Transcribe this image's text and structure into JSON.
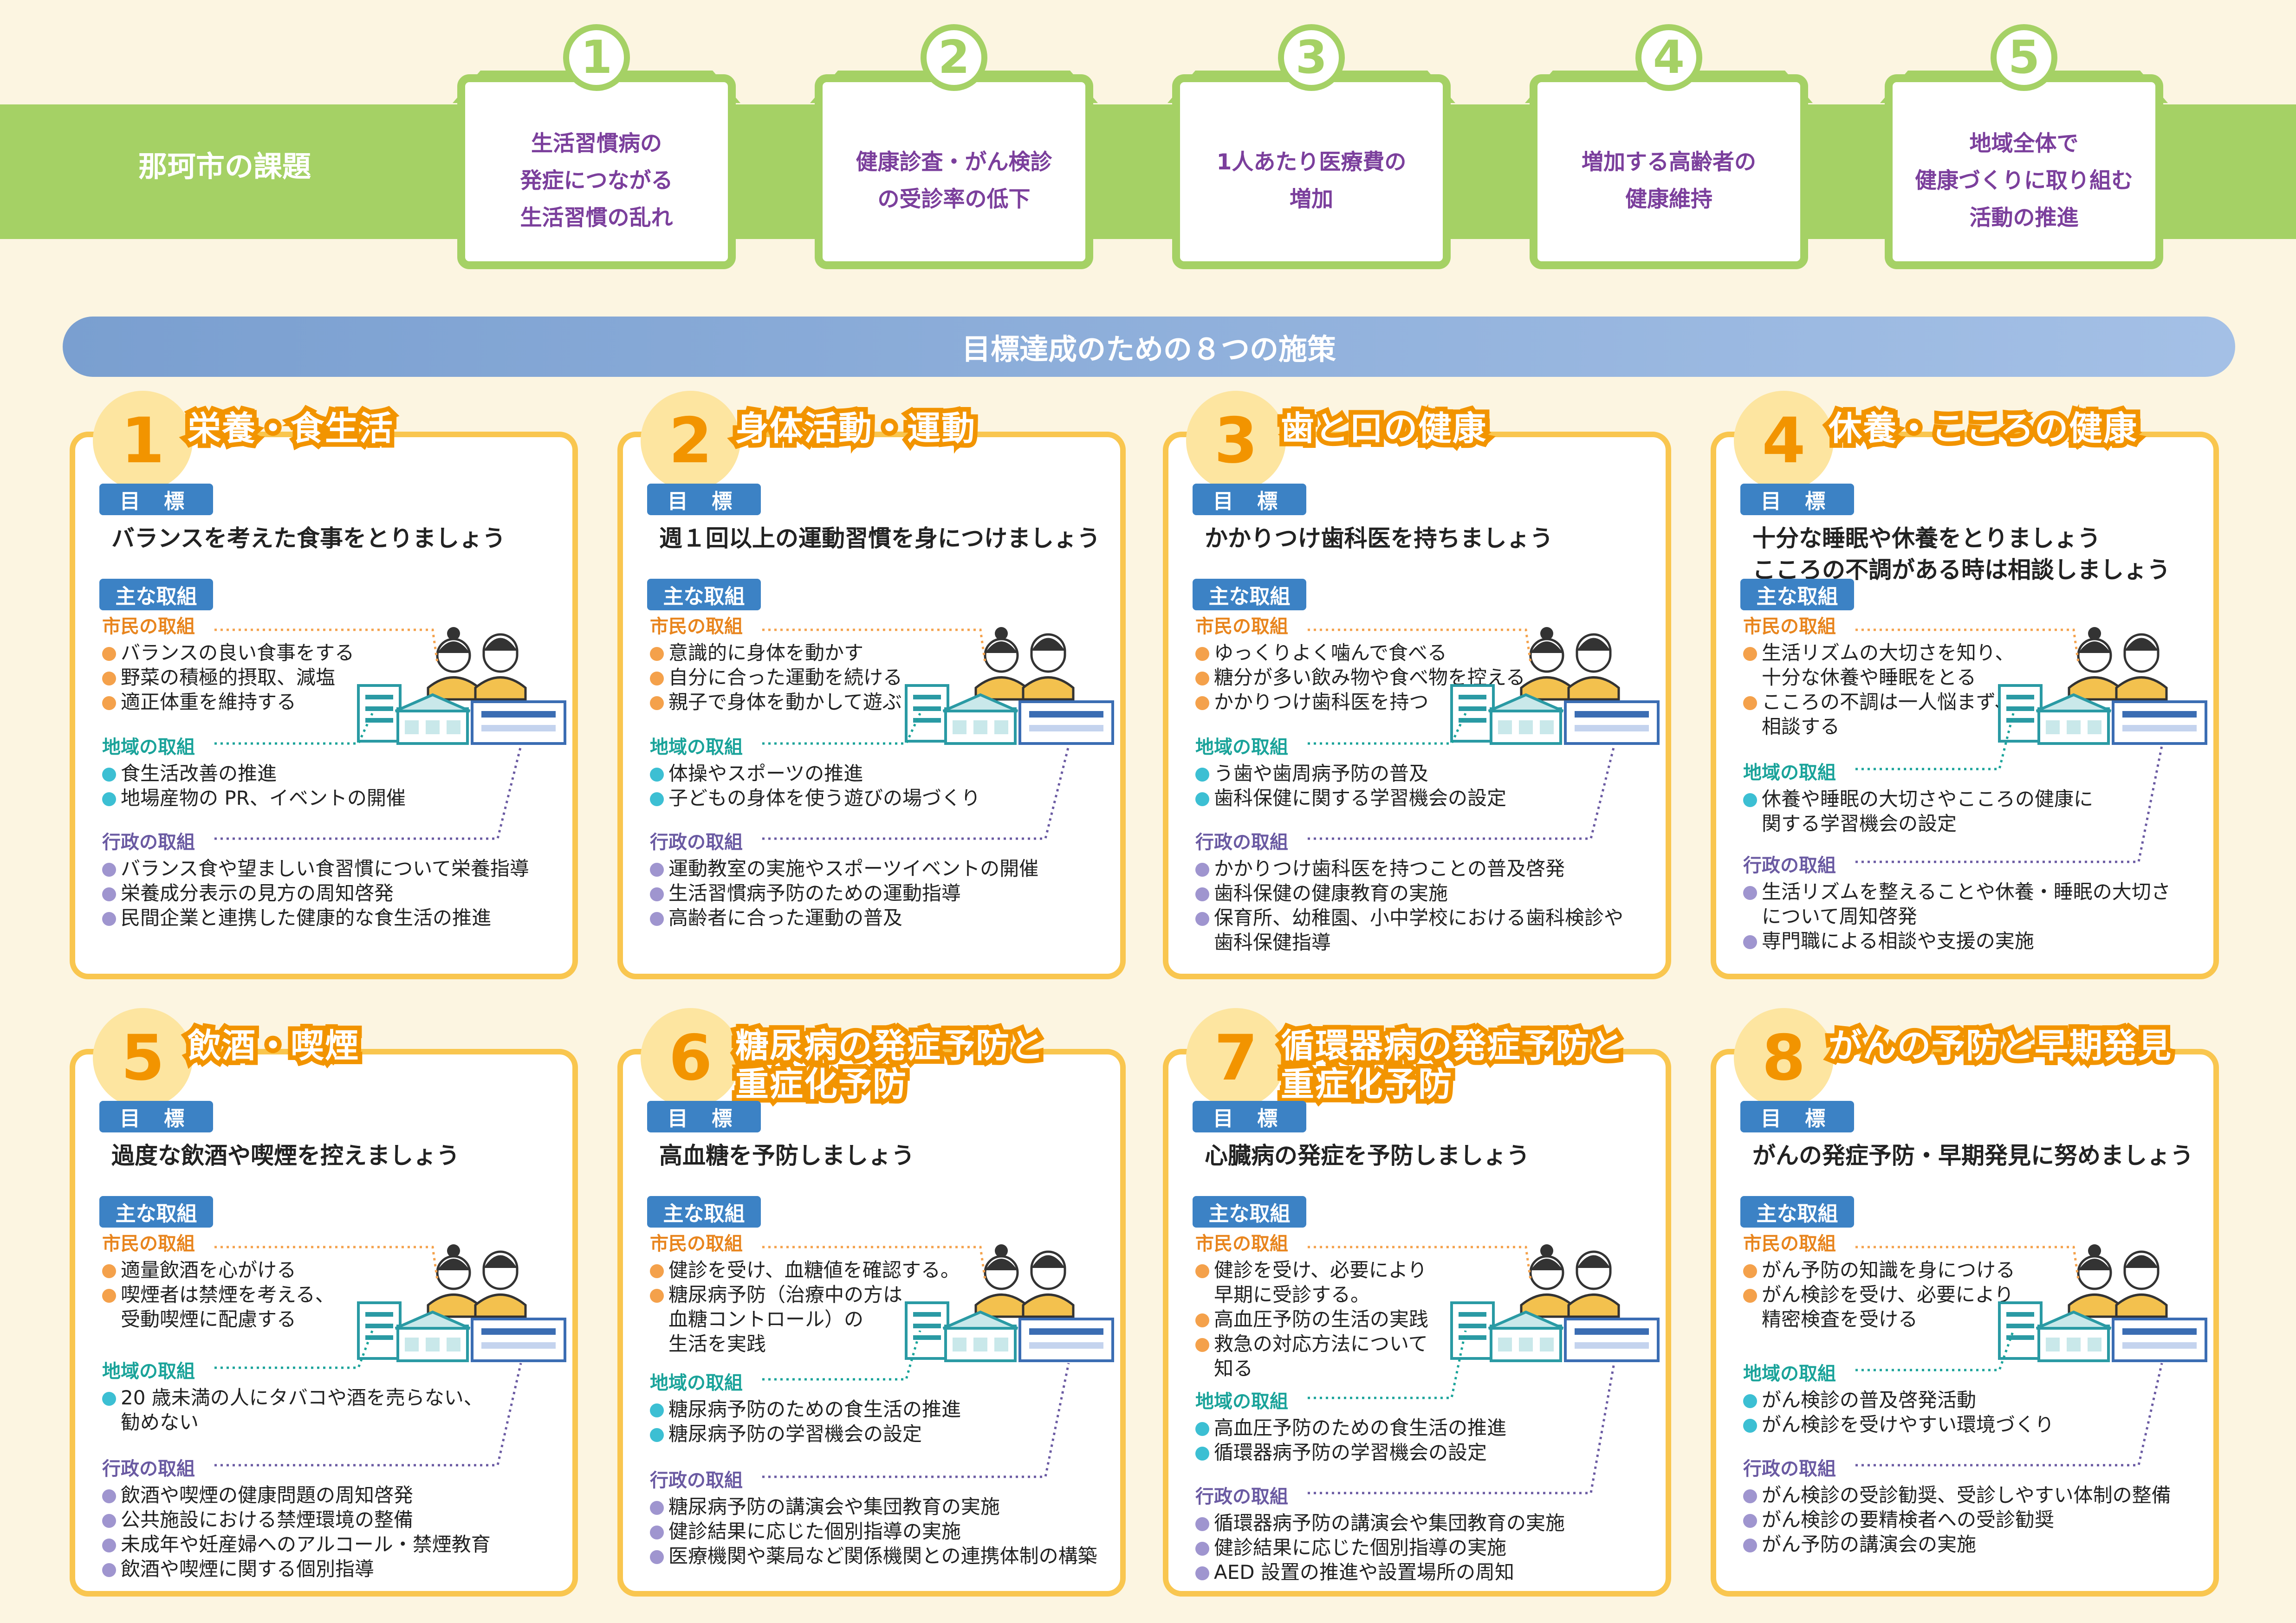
{
  "issues_title": "那珂市の課題",
  "issues": [
    {
      "num": "1",
      "text": "生活習慣病の\n発症につながる\n生活習慣の乱れ"
    },
    {
      "num": "2",
      "text": "健康診査・がん検診\nの受診率の低下"
    },
    {
      "num": "3",
      "text": "1人あたり医療費の\n増加"
    },
    {
      "num": "4",
      "text": "増加する高齢者の\n健康維持"
    },
    {
      "num": "5",
      "text": "地域全体で\n健康づくりに取り組む\n活動の推進"
    }
  ],
  "measures_title": "目標達成のための８つの施策",
  "labels": {
    "goal": "目 標",
    "main": "主な取組",
    "citizen": "市民の取組",
    "region": "地域の取組",
    "admin": "行政の取組"
  },
  "cards": [
    {
      "num": "1",
      "title": "栄養・食生活",
      "goal": "バランスを考えた食事をとりましょう",
      "citizen": [
        "バランスの良い食事をする",
        "野菜の積極的摂取、減塩",
        "適正体重を維持する"
      ],
      "region": [
        "食生活改善の推進",
        "地場産物の PR、イベントの開催"
      ],
      "admin": [
        "バランス食や望ましい食習慣について栄養指導",
        "栄養成分表示の見方の周知啓発",
        "民間企業と連携した健康的な食生活の推進"
      ]
    },
    {
      "num": "2",
      "title": "身体活動・運動",
      "goal": "週１回以上の運動習慣を身につけましょう",
      "citizen": [
        "意識的に身体を動かす",
        "自分に合った運動を続ける",
        "親子で身体を動かして遊ぶ"
      ],
      "region": [
        "体操やスポーツの推進",
        "子どもの身体を使う遊びの場づくり"
      ],
      "admin": [
        "運動教室の実施やスポーツイベントの開催",
        "生活習慣病予防のための運動指導",
        "高齢者に合った運動の普及"
      ]
    },
    {
      "num": "3",
      "title": "歯と口の健康",
      "goal": "かかりつけ歯科医を持ちましょう",
      "citizen": [
        "ゆっくりよく噛んで食べる",
        "糖分が多い飲み物や食べ物を控える",
        "かかりつけ歯科医を持つ"
      ],
      "region": [
        "う歯や歯周病予防の普及",
        "歯科保健に関する学習機会の設定"
      ],
      "admin": [
        "かかりつけ歯科医を持つことの普及啓発",
        "歯科保健の健康教育の実施",
        "保育所、幼稚園、小中学校における歯科検診や\n歯科保健指導"
      ]
    },
    {
      "num": "4",
      "title": "休養・こころの健康",
      "goal": "十分な睡眠や休養をとりましょう\nこころの不調がある時は相談しましょう",
      "citizen": [
        "生活リズムの大切さを知り、\n十分な休養や睡眠をとる",
        "こころの不調は一人悩まず、\n相談する"
      ],
      "region": [
        "休養や睡眠の大切さやこころの健康に\n関する学習機会の設定"
      ],
      "admin": [
        "生活リズムを整えることや休養・睡眠の大切さ\nについて周知啓発",
        "専門職による相談や支援の実施"
      ]
    },
    {
      "num": "5",
      "title": "飲酒・喫煙",
      "goal": "過度な飲酒や喫煙を控えましょう",
      "citizen": [
        "適量飲酒を心がける",
        "喫煙者は禁煙を考える、\n受動喫煙に配慮する"
      ],
      "region": [
        "20 歳未満の人にタバコや酒を売らない、\n勧めない"
      ],
      "admin": [
        "飲酒や喫煙の健康問題の周知啓発",
        "公共施設における禁煙環境の整備",
        "未成年や妊産婦へのアルコール・禁煙教育",
        "飲酒や喫煙に関する個別指導"
      ]
    },
    {
      "num": "6",
      "title": "糖尿病の発症予防と\n重症化予防",
      "goal": "高血糖を予防しましょう",
      "citizen": [
        "健診を受け、血糖値を確認する。",
        "糖尿病予防（治療中の方は\n血糖コントロール）の\n生活を実践"
      ],
      "region": [
        "糖尿病予防のための食生活の推進",
        "糖尿病予防の学習機会の設定"
      ],
      "admin": [
        "糖尿病予防の講演会や集団教育の実施",
        "健診結果に応じた個別指導の実施",
        "医療機関や薬局など関係機関との連携体制の構築"
      ]
    },
    {
      "num": "7",
      "title": "循環器病の発症予防と\n重症化予防",
      "goal": "心臓病の発症を予防しましょう",
      "citizen": [
        "健診を受け、必要により\n早期に受診する。",
        "高血圧予防の生活の実践",
        "救急の対応方法について\n知る"
      ],
      "region": [
        "高血圧予防のための食生活の推進",
        "循環器病予防の学習機会の設定"
      ],
      "admin": [
        "循環器病予防の講演会や集団教育の実施",
        "健診結果に応じた個別指導の実施",
        "AED 設置の推進や設置場所の周知"
      ]
    },
    {
      "num": "8",
      "title": "がんの予防と早期発見",
      "goal": "がんの発症予防・早期発見に努めましょう",
      "citizen": [
        "がん予防の知識を身につける",
        "がん検診を受け、必要により\n精密検査を受ける"
      ],
      "region": [
        "がん検診の普及啓発活動",
        "がん検診を受けやすい環境づくり"
      ],
      "admin": [
        "がん検診の受診勧奨、受診しやすい体制の整備",
        "がん検診の要精検者への受診勧奨",
        "がん予防の講演会の実施"
      ]
    }
  ],
  "colors": {
    "green": "#a5d165",
    "purple": "#7b3f9c",
    "orange": "#f29400",
    "yellow": "#f9c64f",
    "blue": "#3c82c5"
  }
}
